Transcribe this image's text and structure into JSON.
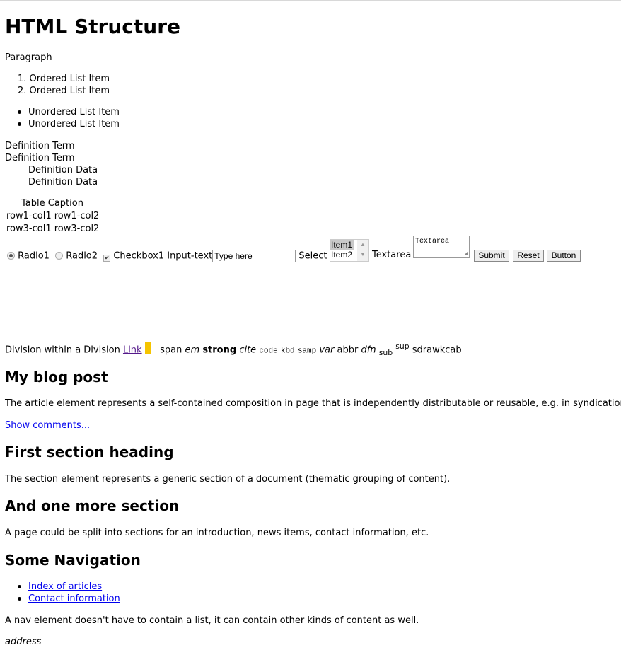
{
  "heading": "HTML Structure",
  "paragraph": "Paragraph",
  "ordered_list": [
    "Ordered List Item",
    "Ordered List Item"
  ],
  "unordered_list": [
    "Unordered List Item",
    "Unordered List Item"
  ],
  "definitions": {
    "terms": [
      "Definition Term",
      "Definition Term"
    ],
    "data": [
      "Definition Data",
      "Definition Data"
    ]
  },
  "table": {
    "caption": "Table Caption",
    "rows": [
      [
        "row1-col1",
        "row1-col2"
      ],
      [
        "row3-col1",
        "row3-col2"
      ]
    ]
  },
  "form": {
    "radio1": "Radio1",
    "radio2": "Radio2",
    "checkbox1": "Checkbox1",
    "input_label": "Input-text",
    "input_value": "Type here",
    "select_label": "Select",
    "select_options": [
      "Item1",
      "Item2"
    ],
    "textarea_label": "Textarea",
    "textarea_value": "Textarea",
    "submit": "Submit",
    "reset": "Reset",
    "button": "Button"
  },
  "inline": {
    "division": "Division within a Division",
    "link": "Link",
    "span": "span",
    "em": "em",
    "strong": "strong",
    "cite": "cite",
    "code": "code",
    "kbd": "kbd",
    "samp": "samp",
    "var": "var",
    "abbr": "abbr",
    "dfn": "dfn",
    "sub": "sub",
    "sup": "sup",
    "bdo": "sdrawkcab"
  },
  "article": {
    "title": "My blog post",
    "text": "The article element represents a self-contained composition in page that is independently distributable or reusable, e.g. in syndication.",
    "link": "Show comments..."
  },
  "section1": {
    "title": "First section heading",
    "text": "The section element represents a generic section of a document (thematic grouping of content)."
  },
  "section2": {
    "title": "And one more section",
    "text": "A page could be split into sections for an introduction, news items, contact information, etc."
  },
  "nav": {
    "title": "Some Navigation",
    "links": [
      "Index of articles",
      "Contact information"
    ],
    "text": "A nav element doesn't have to contain a list, it can contain other kinds of content as well."
  },
  "address": "address",
  "colors": {
    "link": "#0000ee",
    "visited": "#551a8b",
    "mark": "#f5c400"
  }
}
